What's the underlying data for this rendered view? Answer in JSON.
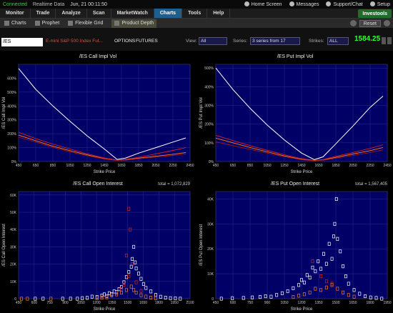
{
  "status": {
    "connected": "Connected",
    "realtime": "Realtime Data",
    "datetime": "Jun, 21  00:11:50",
    "links": [
      "Home Screen",
      "Messages",
      "Support/Chat",
      "Setup"
    ]
  },
  "menu": {
    "tabs": [
      "Monitor",
      "Trade",
      "Analyze",
      "Scan",
      "MarketWatch",
      "Charts",
      "Tools",
      "Help"
    ],
    "active": "Charts",
    "brand": "Investools"
  },
  "subtoolbar": {
    "items": [
      "Charts",
      "Prophet",
      "Flexible Grid",
      "Product Depth"
    ],
    "active": "Product Depth",
    "reset": "Reset"
  },
  "controls": {
    "symbol": "/ES",
    "description": "E-mini S&P 500 Index Fut...",
    "options_label": "OPTIONS",
    "futures_label": "FUTURES",
    "view_label": "View:",
    "view_value": "All",
    "series_label": "Series:",
    "series_value": "3 series from 17",
    "strikes_label": "Strikes:",
    "strikes_value": "ALL",
    "last_price": "1584.25"
  },
  "colors": {
    "plot_bg": "#000066",
    "grid": "#2b2b8f",
    "curve_white": "#ffffff",
    "curve_red": "#d82020",
    "curve_orange": "#ff7a1a",
    "curve_darkred": "#a01515"
  },
  "chart_data": [
    {
      "type": "line",
      "title": "/ES Call Impl Vol",
      "xlabel": "Strike Price",
      "ylabel": "/ES Call Impl Vol",
      "xlim": [
        450,
        2450
      ],
      "ylim": [
        0,
        700
      ],
      "x_ticks": [
        "450",
        "650",
        "850",
        "1050",
        "1250",
        "1450",
        "1650",
        "1850",
        "2050",
        "2250",
        "2450"
      ],
      "y_ticks": [
        "0%",
        "100%",
        "200%",
        "300%",
        "400%",
        "500%",
        "600%"
      ],
      "series": [
        {
          "color": "white",
          "x": [
            450,
            650,
            850,
            1050,
            1250,
            1450,
            1600,
            1700,
            1850,
            2050,
            2250,
            2400
          ],
          "y": [
            670,
            520,
            400,
            290,
            185,
            90,
            15,
            25,
            60,
            100,
            140,
            170
          ]
        },
        {
          "color": "red",
          "x": [
            450,
            650,
            850,
            1050,
            1250,
            1450,
            1600,
            1700,
            1850,
            2050,
            2250,
            2400
          ],
          "y": [
            210,
            165,
            125,
            90,
            55,
            25,
            10,
            15,
            30,
            55,
            80,
            100
          ]
        },
        {
          "color": "orange",
          "x": [
            450,
            650,
            850,
            1050,
            1250,
            1450,
            1600,
            1700,
            1850,
            2050,
            2250,
            2400
          ],
          "y": [
            190,
            150,
            110,
            78,
            48,
            20,
            8,
            12,
            24,
            38,
            52,
            65
          ]
        },
        {
          "color": "darkred",
          "x": [
            450,
            650,
            850,
            1050,
            1250,
            1450,
            1600,
            1700,
            1850,
            2050,
            2250,
            2400
          ],
          "y": [
            175,
            140,
            102,
            70,
            42,
            18,
            7,
            10,
            20,
            32,
            44,
            55
          ]
        }
      ]
    },
    {
      "type": "line",
      "title": "/ES Put Impl Vol",
      "xlabel": "Strike Price",
      "ylabel": "/ES Put Impl Vol",
      "xlim": [
        450,
        2450
      ],
      "ylim": [
        0,
        520
      ],
      "x_ticks": [
        "450",
        "650",
        "850",
        "1050",
        "1250",
        "1450",
        "1650",
        "1850",
        "2050",
        "2250",
        "2450"
      ],
      "y_ticks": [
        "0%",
        "100%",
        "200%",
        "300%",
        "400%",
        "500%"
      ],
      "series": [
        {
          "color": "white",
          "x": [
            450,
            650,
            850,
            1050,
            1250,
            1450,
            1600,
            1700,
            1850,
            2050,
            2250,
            2400
          ],
          "y": [
            500,
            385,
            285,
            195,
            115,
            45,
            10,
            25,
            95,
            190,
            290,
            350
          ]
        },
        {
          "color": "red",
          "x": [
            450,
            650,
            850,
            1050,
            1250,
            1450,
            1600,
            1700,
            1850,
            2050,
            2250,
            2400
          ],
          "y": [
            140,
            112,
            85,
            60,
            36,
            15,
            6,
            10,
            28,
            48,
            70,
            90
          ]
        },
        {
          "color": "orange",
          "x": [
            450,
            650,
            850,
            1050,
            1250,
            1450,
            1600,
            1700,
            1850,
            2050,
            2250,
            2400
          ],
          "y": [
            125,
            100,
            75,
            52,
            30,
            12,
            5,
            8,
            22,
            40,
            58,
            75
          ]
        },
        {
          "color": "darkred",
          "x": [
            450,
            650,
            850,
            1050,
            1250,
            1450,
            1600,
            1700,
            1850,
            2050,
            2250,
            2400
          ],
          "y": [
            105,
            85,
            65,
            45,
            26,
            10,
            4,
            7,
            18,
            32,
            48,
            62
          ]
        }
      ]
    },
    {
      "type": "scatter",
      "title": "/ES Call Open Interest",
      "total": "total = 1,072,829",
      "xlabel": "Strike Price",
      "ylabel": "/ES Call Open Interest",
      "xlim": [
        450,
        2200
      ],
      "ylim": [
        0,
        62000
      ],
      "x_ticks": [
        "450",
        "600",
        "750",
        "900",
        "1050",
        "1200",
        "1350",
        "1500",
        "1650",
        "1800",
        "1950",
        "2100"
      ],
      "y_ticks": [
        "0",
        "10K",
        "20K",
        "30K",
        "40K",
        "50K",
        "60K"
      ],
      "points": [
        {
          "x": 480,
          "y": 0,
          "c": "orange"
        },
        {
          "x": 540,
          "y": 0,
          "c": "orange"
        },
        {
          "x": 620,
          "y": 0,
          "c": "white"
        },
        {
          "x": 700,
          "y": 0,
          "c": "white"
        },
        {
          "x": 780,
          "y": 0,
          "c": "orange"
        },
        {
          "x": 900,
          "y": 0,
          "c": "white"
        },
        {
          "x": 980,
          "y": 0,
          "c": "white"
        },
        {
          "x": 1050,
          "y": 0,
          "c": "white"
        },
        {
          "x": 1100,
          "y": 300,
          "c": "white"
        },
        {
          "x": 1150,
          "y": 500,
          "c": "white"
        },
        {
          "x": 1200,
          "y": 1200,
          "c": "white"
        },
        {
          "x": 1250,
          "y": 1000,
          "c": "white"
        },
        {
          "x": 1300,
          "y": 1800,
          "c": "white"
        },
        {
          "x": 1325,
          "y": 2500,
          "c": "white"
        },
        {
          "x": 1350,
          "y": 1500,
          "c": "white"
        },
        {
          "x": 1375,
          "y": 3200,
          "c": "white"
        },
        {
          "x": 1400,
          "y": 2600,
          "c": "white"
        },
        {
          "x": 1425,
          "y": 4200,
          "c": "white"
        },
        {
          "x": 1450,
          "y": 3800,
          "c": "white"
        },
        {
          "x": 1475,
          "y": 5500,
          "c": "white"
        },
        {
          "x": 1500,
          "y": 6800,
          "c": "white"
        },
        {
          "x": 1525,
          "y": 9500,
          "c": "white"
        },
        {
          "x": 1550,
          "y": 12500,
          "c": "white"
        },
        {
          "x": 1575,
          "y": 15500,
          "c": "white"
        },
        {
          "x": 1600,
          "y": 18500,
          "c": "white"
        },
        {
          "x": 1610,
          "y": 23000,
          "c": "white"
        },
        {
          "x": 1625,
          "y": 30000,
          "c": "white"
        },
        {
          "x": 1640,
          "y": 21000,
          "c": "white"
        },
        {
          "x": 1650,
          "y": 17500,
          "c": "white"
        },
        {
          "x": 1675,
          "y": 14500,
          "c": "white"
        },
        {
          "x": 1700,
          "y": 11500,
          "c": "white"
        },
        {
          "x": 1725,
          "y": 8500,
          "c": "white"
        },
        {
          "x": 1750,
          "y": 6200,
          "c": "white"
        },
        {
          "x": 1800,
          "y": 4200,
          "c": "white"
        },
        {
          "x": 1850,
          "y": 2200,
          "c": "white"
        },
        {
          "x": 1900,
          "y": 1100,
          "c": "white"
        },
        {
          "x": 1950,
          "y": 600,
          "c": "white"
        },
        {
          "x": 2000,
          "y": 300,
          "c": "white"
        },
        {
          "x": 2050,
          "y": 200,
          "c": "white"
        },
        {
          "x": 2100,
          "y": 0,
          "c": "white"
        },
        {
          "x": 1575,
          "y": 52000,
          "c": "red"
        },
        {
          "x": 1590,
          "y": 40000,
          "c": "red"
        },
        {
          "x": 1550,
          "y": 25000,
          "c": "red"
        },
        {
          "x": 1610,
          "y": 20000,
          "c": "red"
        },
        {
          "x": 1575,
          "y": 13000,
          "c": "red"
        },
        {
          "x": 1525,
          "y": 8000,
          "c": "red"
        },
        {
          "x": 1650,
          "y": 9500,
          "c": "red"
        },
        {
          "x": 1450,
          "y": 3500,
          "c": "red"
        },
        {
          "x": 1500,
          "y": 5500,
          "c": "red"
        },
        {
          "x": 1700,
          "y": 4500,
          "c": "red"
        },
        {
          "x": 1400,
          "y": 2000,
          "c": "orange"
        },
        {
          "x": 1450,
          "y": 2500,
          "c": "orange"
        },
        {
          "x": 1500,
          "y": 3500,
          "c": "orange"
        },
        {
          "x": 1550,
          "y": 5000,
          "c": "orange"
        },
        {
          "x": 1600,
          "y": 7000,
          "c": "orange"
        },
        {
          "x": 1625,
          "y": 5000,
          "c": "orange"
        },
        {
          "x": 1650,
          "y": 3500,
          "c": "orange"
        },
        {
          "x": 1700,
          "y": 2000,
          "c": "orange"
        },
        {
          "x": 1750,
          "y": 1200,
          "c": "orange"
        },
        {
          "x": 1350,
          "y": 800,
          "c": "orange"
        },
        {
          "x": 1300,
          "y": 600,
          "c": "orange"
        },
        {
          "x": 1800,
          "y": 600,
          "c": "orange"
        },
        {
          "x": 1850,
          "y": 300,
          "c": "orange"
        },
        {
          "x": 1250,
          "y": 300,
          "c": "orange"
        }
      ]
    },
    {
      "type": "scatter",
      "title": "/ES Put Open Interest",
      "total": "total = 1,567,405",
      "xlabel": "Strike Price",
      "ylabel": "/ES Put Open Interest",
      "xlim": [
        450,
        2000
      ],
      "ylim": [
        0,
        43000
      ],
      "x_ticks": [
        "450",
        "600",
        "750",
        "900",
        "1050",
        "1200",
        "1350",
        "1500",
        "1650",
        "1800",
        "1950"
      ],
      "y_ticks": [
        "0",
        "10K",
        "20K",
        "30K",
        "40K"
      ],
      "points": [
        {
          "x": 500,
          "y": 0,
          "c": "white"
        },
        {
          "x": 600,
          "y": 200,
          "c": "white"
        },
        {
          "x": 700,
          "y": 300,
          "c": "white"
        },
        {
          "x": 780,
          "y": 500,
          "c": "white"
        },
        {
          "x": 850,
          "y": 700,
          "c": "white"
        },
        {
          "x": 900,
          "y": 1000,
          "c": "white"
        },
        {
          "x": 950,
          "y": 800,
          "c": "white"
        },
        {
          "x": 1000,
          "y": 1500,
          "c": "white"
        },
        {
          "x": 1050,
          "y": 2200,
          "c": "white"
        },
        {
          "x": 1100,
          "y": 3000,
          "c": "white"
        },
        {
          "x": 1150,
          "y": 4200,
          "c": "white"
        },
        {
          "x": 1200,
          "y": 5500,
          "c": "white"
        },
        {
          "x": 1225,
          "y": 7500,
          "c": "white"
        },
        {
          "x": 1250,
          "y": 6500,
          "c": "white"
        },
        {
          "x": 1275,
          "y": 9500,
          "c": "white"
        },
        {
          "x": 1300,
          "y": 8500,
          "c": "white"
        },
        {
          "x": 1325,
          "y": 12500,
          "c": "white"
        },
        {
          "x": 1350,
          "y": 11000,
          "c": "white"
        },
        {
          "x": 1375,
          "y": 15000,
          "c": "white"
        },
        {
          "x": 1400,
          "y": 12000,
          "c": "white"
        },
        {
          "x": 1425,
          "y": 18000,
          "c": "white"
        },
        {
          "x": 1450,
          "y": 14000,
          "c": "white"
        },
        {
          "x": 1475,
          "y": 22000,
          "c": "white"
        },
        {
          "x": 1500,
          "y": 16000,
          "c": "white"
        },
        {
          "x": 1515,
          "y": 25000,
          "c": "white"
        },
        {
          "x": 1525,
          "y": 30000,
          "c": "white"
        },
        {
          "x": 1540,
          "y": 40000,
          "c": "white"
        },
        {
          "x": 1550,
          "y": 24000,
          "c": "white"
        },
        {
          "x": 1575,
          "y": 19000,
          "c": "white"
        },
        {
          "x": 1600,
          "y": 13000,
          "c": "white"
        },
        {
          "x": 1625,
          "y": 9000,
          "c": "white"
        },
        {
          "x": 1650,
          "y": 6000,
          "c": "white"
        },
        {
          "x": 1700,
          "y": 3500,
          "c": "white"
        },
        {
          "x": 1750,
          "y": 2000,
          "c": "white"
        },
        {
          "x": 1800,
          "y": 1000,
          "c": "white"
        },
        {
          "x": 1850,
          "y": 500,
          "c": "white"
        },
        {
          "x": 1900,
          "y": 300,
          "c": "white"
        },
        {
          "x": 1950,
          "y": 0,
          "c": "white"
        },
        {
          "x": 1325,
          "y": 15000,
          "c": "red"
        },
        {
          "x": 1400,
          "y": 9000,
          "c": "red"
        },
        {
          "x": 1450,
          "y": 7000,
          "c": "red"
        },
        {
          "x": 1500,
          "y": 6000,
          "c": "red"
        },
        {
          "x": 1350,
          "y": 4000,
          "c": "orange"
        },
        {
          "x": 1400,
          "y": 3500,
          "c": "orange"
        },
        {
          "x": 1450,
          "y": 4500,
          "c": "orange"
        },
        {
          "x": 1500,
          "y": 5500,
          "c": "orange"
        },
        {
          "x": 1550,
          "y": 4000,
          "c": "orange"
        },
        {
          "x": 1600,
          "y": 2500,
          "c": "orange"
        },
        {
          "x": 1300,
          "y": 2500,
          "c": "orange"
        },
        {
          "x": 1250,
          "y": 1800,
          "c": "orange"
        },
        {
          "x": 1200,
          "y": 1200,
          "c": "orange"
        },
        {
          "x": 1650,
          "y": 1500,
          "c": "orange"
        },
        {
          "x": 1700,
          "y": 800,
          "c": "orange"
        },
        {
          "x": 1150,
          "y": 700,
          "c": "orange"
        }
      ]
    }
  ]
}
